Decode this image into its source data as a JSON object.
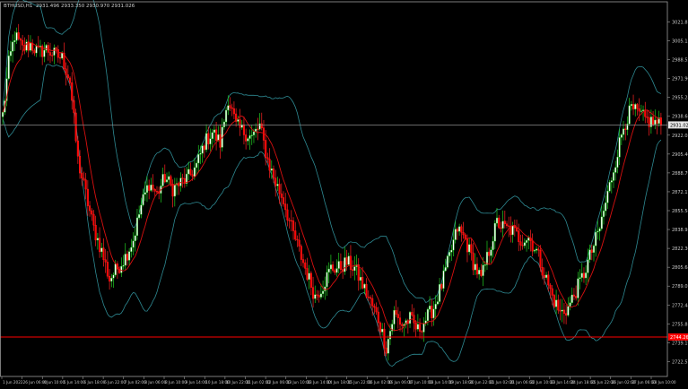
{
  "header": {
    "symbol": "BTHUSD,H1",
    "ohlc": "2931.496  2933.350  2930.970  2931.026"
  },
  "colors": {
    "background": "#000000",
    "frame": "#9a9a9a",
    "bull_fill": "#ffffff",
    "bull_edge": "#22cc22",
    "bear_fill": "#ff0000",
    "bear_edge": "#ff2222",
    "ma_line": "#d81010",
    "band_line": "#2e8a93",
    "bid_line": "#8a8a8a",
    "level_line": "#ff0000",
    "tick_text": "#c8c8c8"
  },
  "chart_data": {
    "type": "candlestick",
    "ylim": [
      2709.5,
      3039.5
    ],
    "y_ticks": [
      "3021.870",
      "3005.150",
      "2988.525",
      "2971.906",
      "2955.285",
      "2938.660",
      "2922.036",
      "2905.400",
      "2888.795",
      "2872.175",
      "2855.540",
      "2838.930",
      "2822.305",
      "2805.680",
      "2789.070",
      "2772.440",
      "2755.815",
      "2739.190",
      "2722.570"
    ],
    "x_ticks": [
      "1 Jun 2022",
      "26 Jun 06:00",
      "4 Jun 10:00",
      "5 Jun 14:00",
      "6 Jun 18:00",
      "6 Jun 22:00",
      "7 Jun 02:00",
      "8 Jun 06:00",
      "8 Jun 10:00",
      "9 Jun 14:00",
      "10 Jun 18:00",
      "10 Jun 22:00",
      "11 Jun 02:00",
      "12 Jun 06:00",
      "13 Jun 10:00",
      "13 Jun 14:00",
      "14 Jun 18:00",
      "15 Jun 22:00",
      "16 Jun 02:00",
      "16 Jun 06:00",
      "17 Jun 10:00",
      "18 Jun 14:00",
      "19 Jun 18:00",
      "20 Jun 22:00",
      "21 Jun 02:00",
      "21 Jun 06:00",
      "22 Jun 10:00",
      "23 Jun 14:00",
      "24 Jun 18:00",
      "25 Jun 22:00",
      "26 Jun 02:00",
      "27 Jun 06:00",
      "28 Jun 10:00"
    ],
    "current_price": "2931.026",
    "level_price": "2744.260",
    "level_value": 2744.26,
    "close_path": [
      [
        0,
        2940
      ],
      [
        3,
        2985
      ],
      [
        6,
        3010
      ],
      [
        10,
        2998
      ],
      [
        14,
        3002
      ],
      [
        18,
        2995
      ],
      [
        22,
        2998
      ],
      [
        26,
        2993
      ],
      [
        30,
        2990
      ],
      [
        34,
        2970
      ],
      [
        38,
        2900
      ],
      [
        42,
        2870
      ],
      [
        46,
        2840
      ],
      [
        50,
        2820
      ],
      [
        54,
        2795
      ],
      [
        58,
        2805
      ],
      [
        62,
        2815
      ],
      [
        66,
        2830
      ],
      [
        70,
        2860
      ],
      [
        74,
        2880
      ],
      [
        78,
        2870
      ],
      [
        82,
        2885
      ],
      [
        86,
        2875
      ],
      [
        90,
        2880
      ],
      [
        94,
        2885
      ],
      [
        98,
        2895
      ],
      [
        102,
        2915
      ],
      [
        106,
        2925
      ],
      [
        110,
        2915
      ],
      [
        114,
        2955
      ],
      [
        118,
        2930
      ],
      [
        122,
        2925
      ],
      [
        126,
        2920
      ],
      [
        130,
        2930
      ],
      [
        134,
        2900
      ],
      [
        138,
        2880
      ],
      [
        142,
        2865
      ],
      [
        146,
        2840
      ],
      [
        150,
        2820
      ],
      [
        154,
        2800
      ],
      [
        158,
        2780
      ],
      [
        162,
        2790
      ],
      [
        166,
        2805
      ],
      [
        170,
        2805
      ],
      [
        174,
        2810
      ],
      [
        178,
        2805
      ],
      [
        182,
        2790
      ],
      [
        186,
        2775
      ],
      [
        190,
        2760
      ],
      [
        194,
        2735
      ],
      [
        198,
        2765
      ],
      [
        202,
        2755
      ],
      [
        206,
        2760
      ],
      [
        210,
        2750
      ],
      [
        214,
        2760
      ],
      [
        218,
        2770
      ],
      [
        222,
        2790
      ],
      [
        226,
        2815
      ],
      [
        230,
        2840
      ],
      [
        234,
        2830
      ],
      [
        238,
        2810
      ],
      [
        242,
        2795
      ],
      [
        246,
        2820
      ],
      [
        250,
        2845
      ],
      [
        254,
        2840
      ],
      [
        258,
        2838
      ],
      [
        262,
        2830
      ],
      [
        266,
        2832
      ],
      [
        270,
        2820
      ],
      [
        274,
        2800
      ],
      [
        278,
        2780
      ],
      [
        282,
        2765
      ],
      [
        286,
        2770
      ],
      [
        290,
        2785
      ],
      [
        294,
        2800
      ],
      [
        298,
        2820
      ],
      [
        302,
        2840
      ],
      [
        306,
        2870
      ],
      [
        310,
        2900
      ],
      [
        314,
        2930
      ],
      [
        318,
        2945
      ],
      [
        322,
        2940
      ],
      [
        326,
        2935
      ],
      [
        330,
        2933
      ],
      [
        333,
        2931
      ]
    ]
  }
}
